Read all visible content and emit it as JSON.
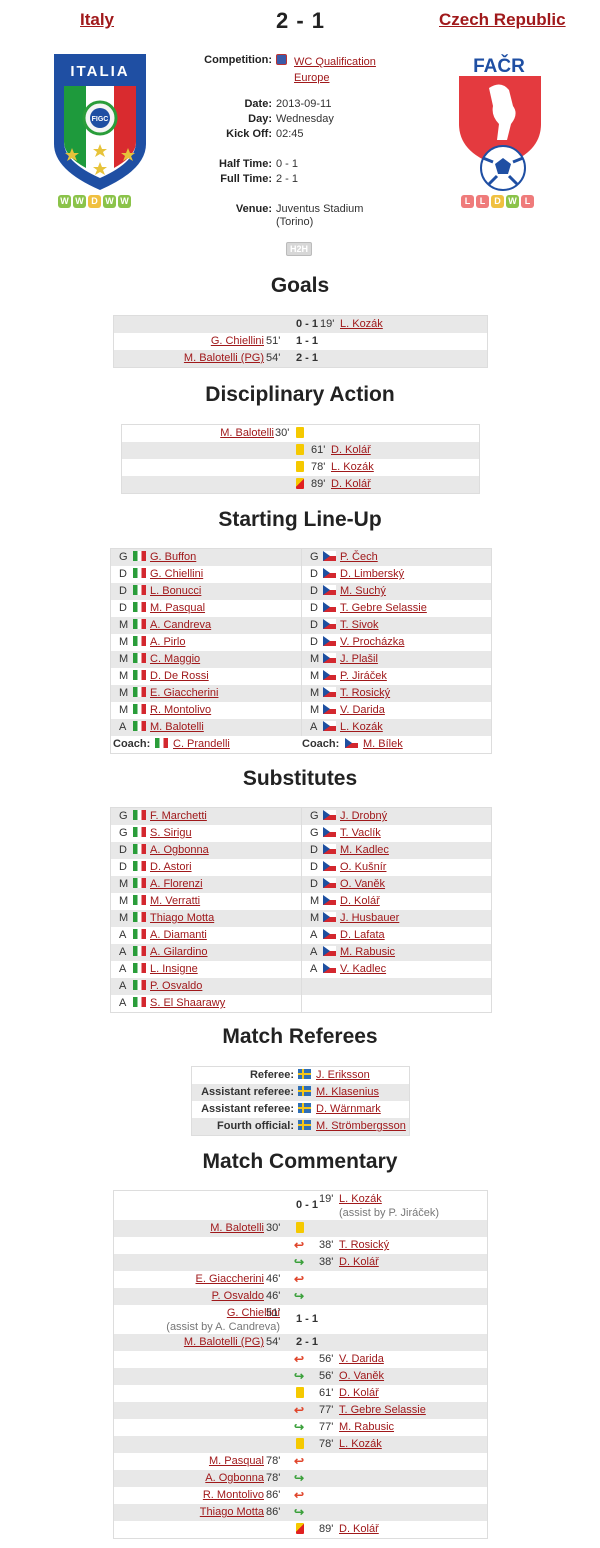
{
  "match": {
    "home": "Italy",
    "away": "Czech Republic",
    "score": "2 - 1",
    "home_form": [
      "W",
      "W",
      "D",
      "W",
      "W"
    ],
    "away_form": [
      "L",
      "L",
      "D",
      "W",
      "L"
    ],
    "home_logo_text": "ITALIA",
    "home_logo_badge": "FIGC",
    "away_logo_text": "FAČR",
    "info": {
      "competition_label": "Competition:",
      "competition_value": "WC Qualification Europe",
      "date_label": "Date:",
      "date_value": "2013-09-11",
      "day_label": "Day:",
      "day_value": "Wednesday",
      "kickoff_label": "Kick Off:",
      "kickoff_value": "02:45",
      "halftime_label": "Half Time:",
      "halftime_value": "0 - 1",
      "fulltime_label": "Full Time:",
      "fulltime_value": "2 - 1",
      "venue_label": "Venue:",
      "venue_value": "Juventus Stadium",
      "venue_city": "(Torino)",
      "h2h": "H2H"
    }
  },
  "sections": {
    "goals": "Goals",
    "discipline": "Disciplinary Action",
    "lineup": "Starting Line-Up",
    "subs": "Substitutes",
    "referees": "Match Referees",
    "commentary": "Match Commentary"
  },
  "goals": [
    {
      "home": "",
      "min_h": "",
      "score": "0 - 1",
      "min_a": "19'",
      "away": "L. Kozák"
    },
    {
      "home": "G. Chiellini",
      "min_h": "51'",
      "score": "1 - 1",
      "min_a": "",
      "away": ""
    },
    {
      "home": "M. Balotelli (PG)",
      "min_h": "54'",
      "score": "2 - 1",
      "min_a": "",
      "away": ""
    }
  ],
  "discipline": [
    {
      "home": "M. Balotelli",
      "min_h": "30'",
      "card": "yellow",
      "min_a": "",
      "away": ""
    },
    {
      "home": "",
      "min_h": "",
      "card": "yellow",
      "min_a": "61'",
      "away": "D. Kolář"
    },
    {
      "home": "",
      "min_h": "",
      "card": "yellow",
      "min_a": "78'",
      "away": "L. Kozák"
    },
    {
      "home": "",
      "min_h": "",
      "card": "red",
      "min_a": "89'",
      "away": "D. Kolář"
    }
  ],
  "lineup": [
    {
      "hp": "G",
      "h": "G. Buffon",
      "ap": "G",
      "a": "P. Čech"
    },
    {
      "hp": "D",
      "h": "G. Chiellini",
      "ap": "D",
      "a": "D. Limberský"
    },
    {
      "hp": "D",
      "h": "L. Bonucci",
      "ap": "D",
      "a": "M. Suchý"
    },
    {
      "hp": "D",
      "h": "M. Pasqual",
      "ap": "D",
      "a": "T. Gebre Selassie"
    },
    {
      "hp": "M",
      "h": "A. Candreva",
      "ap": "D",
      "a": "T. Sivok"
    },
    {
      "hp": "M",
      "h": "A. Pirlo",
      "ap": "D",
      "a": "V. Procházka"
    },
    {
      "hp": "M",
      "h": "C. Maggio",
      "ap": "M",
      "a": "J. Plašil"
    },
    {
      "hp": "M",
      "h": "D. De Rossi",
      "ap": "M",
      "a": "P. Jiráček"
    },
    {
      "hp": "M",
      "h": "E. Giaccherini",
      "ap": "M",
      "a": "T. Rosický"
    },
    {
      "hp": "M",
      "h": "R. Montolivo",
      "ap": "M",
      "a": "V. Darida"
    },
    {
      "hp": "A",
      "h": "M. Balotelli",
      "ap": "A",
      "a": "L. Kozák"
    }
  ],
  "coach": {
    "label": "Coach:",
    "home": "C. Prandelli",
    "away": "M. Bílek"
  },
  "subs": [
    {
      "hp": "G",
      "h": "F. Marchetti",
      "ap": "G",
      "a": "J. Drobný"
    },
    {
      "hp": "G",
      "h": "S. Sirigu",
      "ap": "G",
      "a": "T. Vaclík"
    },
    {
      "hp": "D",
      "h": "A. Ogbonna",
      "ap": "D",
      "a": "M. Kadlec"
    },
    {
      "hp": "D",
      "h": "D. Astori",
      "ap": "D",
      "a": "O. Kušnír"
    },
    {
      "hp": "M",
      "h": "A. Florenzi",
      "ap": "D",
      "a": "O. Vaněk"
    },
    {
      "hp": "M",
      "h": "M. Verratti",
      "ap": "M",
      "a": "D. Kolář"
    },
    {
      "hp": "M",
      "h": "Thiago Motta",
      "ap": "M",
      "a": "J. Husbauer"
    },
    {
      "hp": "A",
      "h": "A. Diamanti",
      "ap": "A",
      "a": "D. Lafata"
    },
    {
      "hp": "A",
      "h": "A. Gilardino",
      "ap": "A",
      "a": "M. Rabusic"
    },
    {
      "hp": "A",
      "h": "L. Insigne",
      "ap": "A",
      "a": "V. Kadlec"
    },
    {
      "hp": "A",
      "h": "P. Osvaldo",
      "ap": "",
      "a": ""
    },
    {
      "hp": "A",
      "h": "S. El Shaarawy",
      "ap": "",
      "a": ""
    }
  ],
  "referees": [
    {
      "role": "Referee:",
      "name": "J. Eriksson"
    },
    {
      "role": "Assistant referee:",
      "name": "M. Klasenius"
    },
    {
      "role": "Assistant referee:",
      "name": "D. Wärnmark"
    },
    {
      "role": "Fourth official:",
      "name": "M. Strömbergsson"
    }
  ],
  "commentary": [
    {
      "home": "",
      "min_h": "",
      "mid": "0 - 1",
      "type": "score",
      "min_a": "19'",
      "away": "L. Kozák",
      "assist_a": "(assist by P. Jiráček)"
    },
    {
      "home": "M. Balotelli",
      "min_h": "30'",
      "mid": "",
      "type": "yellow",
      "min_a": "",
      "away": ""
    },
    {
      "home": "",
      "min_h": "",
      "mid": "",
      "type": "out",
      "min_a": "38'",
      "away": "T. Rosický"
    },
    {
      "home": "",
      "min_h": "",
      "mid": "",
      "type": "in",
      "min_a": "38'",
      "away": "D. Kolář"
    },
    {
      "home": "E. Giaccherini",
      "min_h": "46'",
      "mid": "",
      "type": "out",
      "min_a": "",
      "away": ""
    },
    {
      "home": "P. Osvaldo",
      "min_h": "46'",
      "mid": "",
      "type": "in",
      "min_a": "",
      "away": ""
    },
    {
      "home": "G. Chiellini",
      "min_h": "51'",
      "assist_h": "(assist by A. Candreva)",
      "mid": "1 - 1",
      "type": "score",
      "min_a": "",
      "away": ""
    },
    {
      "home": "M. Balotelli (PG)",
      "min_h": "54'",
      "mid": "2 - 1",
      "type": "score",
      "min_a": "",
      "away": ""
    },
    {
      "home": "",
      "min_h": "",
      "mid": "",
      "type": "out",
      "min_a": "56'",
      "away": "V. Darida"
    },
    {
      "home": "",
      "min_h": "",
      "mid": "",
      "type": "in",
      "min_a": "56'",
      "away": "O. Vaněk"
    },
    {
      "home": "",
      "min_h": "",
      "mid": "",
      "type": "yellow",
      "min_a": "61'",
      "away": "D. Kolář"
    },
    {
      "home": "",
      "min_h": "",
      "mid": "",
      "type": "out",
      "min_a": "77'",
      "away": "T. Gebre Selassie"
    },
    {
      "home": "",
      "min_h": "",
      "mid": "",
      "type": "in",
      "min_a": "77'",
      "away": "M. Rabusic"
    },
    {
      "home": "",
      "min_h": "",
      "mid": "",
      "type": "yellow",
      "min_a": "78'",
      "away": "L. Kozák"
    },
    {
      "home": "M. Pasqual",
      "min_h": "78'",
      "mid": "",
      "type": "out",
      "min_a": "",
      "away": ""
    },
    {
      "home": "A. Ogbonna",
      "min_h": "78'",
      "mid": "",
      "type": "in",
      "min_a": "",
      "away": ""
    },
    {
      "home": "R. Montolivo",
      "min_h": "86'",
      "mid": "",
      "type": "out",
      "min_a": "",
      "away": ""
    },
    {
      "home": "Thiago Motta",
      "min_h": "86'",
      "mid": "",
      "type": "in",
      "min_a": "",
      "away": ""
    },
    {
      "home": "",
      "min_h": "",
      "mid": "",
      "type": "red",
      "min_a": "89'",
      "away": "D. Kolář"
    }
  ]
}
